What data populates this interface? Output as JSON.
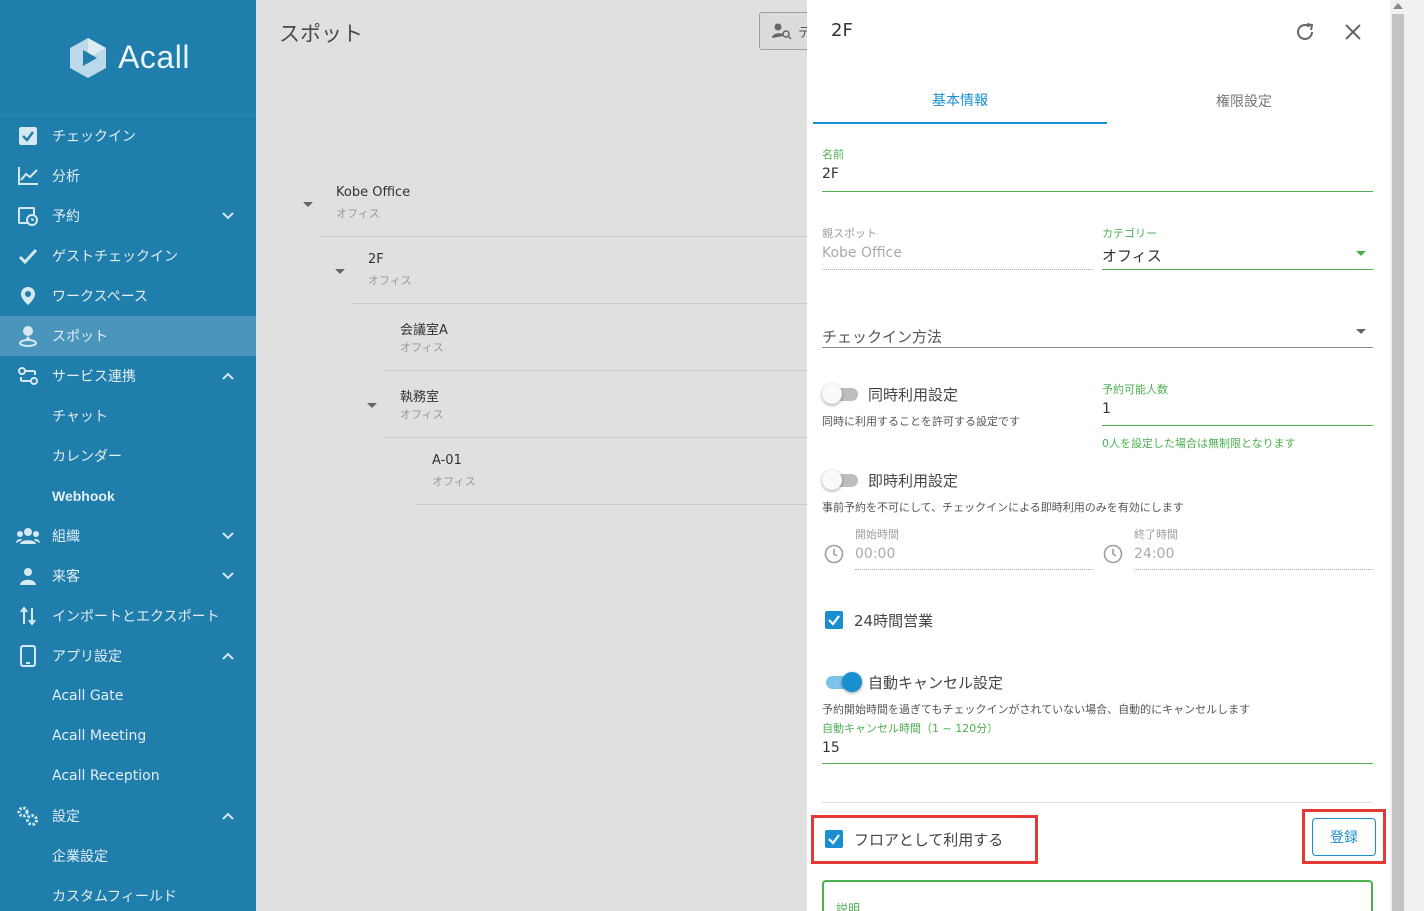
{
  "sidebar": {
    "brand": "Acall",
    "items": [
      {
        "label": "チェックイン",
        "icon": "check-square-icon"
      },
      {
        "label": "分析",
        "icon": "chart-line-icon"
      },
      {
        "label": "予約",
        "icon": "calendar-clock-icon",
        "chevron": "down"
      },
      {
        "label": "ゲストチェックイン",
        "icon": "check-icon"
      },
      {
        "label": "ワークスペース",
        "icon": "map-pin-icon"
      },
      {
        "label": "スポット",
        "icon": "person-pin-icon",
        "active": true
      },
      {
        "label": "サービス連携",
        "icon": "integration-icon",
        "chevron": "up"
      },
      {
        "label": "組織",
        "icon": "group-icon",
        "chevron": "down"
      },
      {
        "label": "来客",
        "icon": "visitor-icon",
        "chevron": "down"
      },
      {
        "label": "インポートとエクスポート",
        "icon": "import-export-icon"
      },
      {
        "label": "アプリ設定",
        "icon": "tablet-icon",
        "chevron": "up"
      },
      {
        "label": "設定",
        "icon": "settings-icon",
        "chevron": "up"
      }
    ],
    "service_sub": [
      "チャット",
      "カレンダー",
      "Webhook"
    ],
    "app_sub": [
      "Acall Gate",
      "Acall Meeting",
      "Acall Reception"
    ],
    "settings_sub": [
      "企業設定",
      "カスタムフィールド"
    ]
  },
  "main": {
    "title": "スポット",
    "search_label": "テ",
    "tree": [
      {
        "name": "Kobe Office",
        "type": "オフィス"
      },
      {
        "name": "2F",
        "type": "オフィス"
      },
      {
        "name": "会議室A",
        "type": "オフィス"
      },
      {
        "name": "執務室",
        "type": "オフィス"
      },
      {
        "name": "A-01",
        "type": "オフィス"
      }
    ]
  },
  "panel": {
    "title": "2F",
    "tabs": [
      "基本情報",
      "権限設定"
    ],
    "name_label": "名前",
    "name_value": "2F",
    "parent_label": "親スポット",
    "parent_value": "Kobe Office",
    "category_label": "カテゴリー",
    "category_value": "オフィス",
    "checkin_method": "チェックイン方法",
    "concurrent_label": "同時利用設定",
    "concurrent_help": "同時に利用することを許可する設定です",
    "capacity_label": "予約可能人数",
    "capacity_value": "1",
    "capacity_help": "0人を設定した場合は無制限となります",
    "instant_label": "即時利用設定",
    "instant_help": "事前予約を不可にして、チェックインによる即時利用のみを有効にします",
    "start_label": "開始時間",
    "start_value": "00:00",
    "end_label": "終了時間",
    "end_value": "24:00",
    "allday_label": "24時間営業",
    "autocancel_label": "自動キャンセル設定",
    "autocancel_help": "予約開始時間を過ぎてもチェックインがされていない場合、自動的にキャンセルします",
    "autocancel_time_label": "自動キャンセル時間（1 ~ 120分）",
    "autocancel_time_value": "15",
    "floor_label": "フロアとして利用する",
    "register_label": "登録",
    "description_label": "説明"
  },
  "colors": {
    "sidebar": "#1f7eab",
    "accent": "#1a8fd0",
    "green": "#4caf50",
    "highlight": "#e53935"
  }
}
